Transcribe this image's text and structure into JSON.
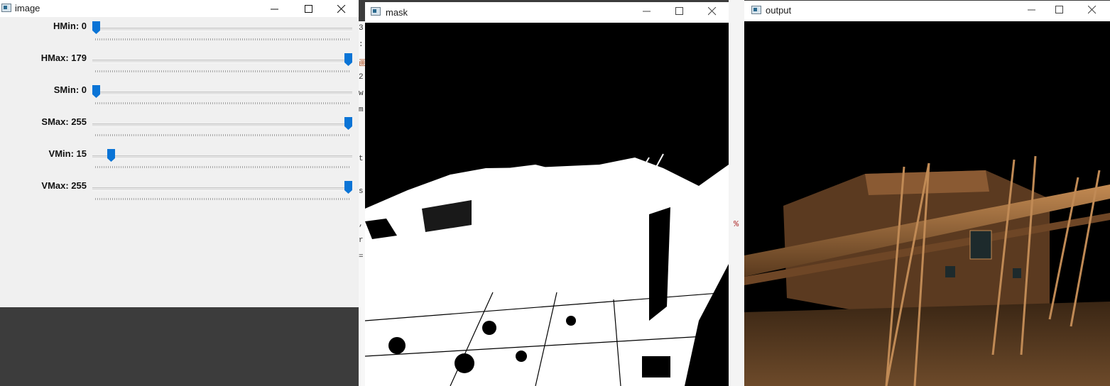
{
  "windows": {
    "image": {
      "title": "image",
      "sliders": [
        {
          "label": "HMin: 0",
          "value": 0,
          "max": 179
        },
        {
          "label": "HMax: 179",
          "value": 179,
          "max": 179
        },
        {
          "label": "SMin: 0",
          "value": 0,
          "max": 255
        },
        {
          "label": "SMax: 255",
          "value": 255,
          "max": 255
        },
        {
          "label": "VMin: 15",
          "value": 15,
          "max": 255
        },
        {
          "label": "VMax: 255",
          "value": 255,
          "max": 255
        }
      ]
    },
    "mask": {
      "title": "mask"
    },
    "output": {
      "title": "output"
    }
  },
  "console": {
    "fragments": [
      "3",
      ":",
      "画",
      "2",
      "w",
      "m",
      "t",
      "s",
      ",",
      "r",
      "="
    ],
    "percent": "%"
  },
  "colors": {
    "slider_thumb": "#0a74d6",
    "mask_white": "#ffffff",
    "mask_black": "#000000",
    "output_scene": "#b07a45"
  },
  "icons": {
    "minimize": "minimize-icon",
    "maximize": "maximize-icon",
    "close": "close-icon",
    "window": "window-app-icon"
  }
}
